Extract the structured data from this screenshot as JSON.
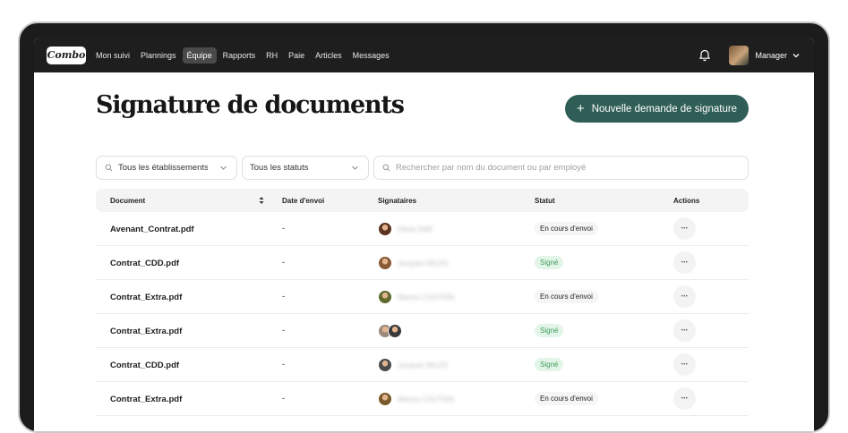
{
  "app": {
    "logo": "Combo"
  },
  "nav": [
    "Mon suivi",
    "Plannings",
    "Équipe",
    "Rapports",
    "RH",
    "Paie",
    "Articles",
    "Messages"
  ],
  "nav_active_index": 2,
  "user": {
    "label": "Manager"
  },
  "page": {
    "title": "Signature de documents",
    "new_request_label": "Nouvelle demande de signature"
  },
  "filters": {
    "establishments": "Tous les établissements",
    "statuses": "Tous les statuts",
    "search_placeholder": "Rechercher par nom du document ou par employé"
  },
  "table": {
    "headers": {
      "document": "Document",
      "date": "Date d'envoi",
      "signers": "Signataires",
      "status": "Statut",
      "actions": "Actions"
    },
    "rows": [
      {
        "document": "Avenant_Contrat.pdf",
        "date": "-",
        "signer_avatars": [
          "#5a3322"
        ],
        "signer_name": "Olivia SIMI",
        "status": "En cours d'envoi",
        "status_kind": "pending",
        "action": "•••"
      },
      {
        "document": "Contrat_CDD.pdf",
        "date": "-",
        "signer_avatars": [
          "#8a5a34"
        ],
        "signer_name": "Jacques MILES",
        "status": "Signé",
        "status_kind": "signed",
        "action": "•••"
      },
      {
        "document": "Contrat_Extra.pdf",
        "date": "-",
        "signer_avatars": [
          "#5f6a2e"
        ],
        "signer_name": "Marina COUTHIN",
        "status": "En cours d'envoi",
        "status_kind": "pending",
        "action": "•••"
      },
      {
        "document": "Contrat_Extra.pdf",
        "date": "-",
        "signer_avatars": [
          "#9a8a7a",
          "#3a3a3a"
        ],
        "signer_name": "",
        "status": "Signé",
        "status_kind": "signed",
        "action": "•••"
      },
      {
        "document": "Contrat_CDD.pdf",
        "date": "-",
        "signer_avatars": [
          "#4a4a4a"
        ],
        "signer_name": "Jacques MILES",
        "status": "Signé",
        "status_kind": "signed",
        "action": "•••"
      },
      {
        "document": "Contrat_Extra.pdf",
        "date": "-",
        "signer_avatars": [
          "#7a5a2a"
        ],
        "signer_name": "Marina COUTHIN",
        "status": "En cours d'envoi",
        "status_kind": "pending",
        "action": "•••"
      }
    ]
  },
  "colors": {
    "primary_button": "#2f5e57",
    "topbar": "#1e1e1e",
    "signed_bg": "#e3f5e8",
    "signed_text": "#3f9a5b"
  }
}
